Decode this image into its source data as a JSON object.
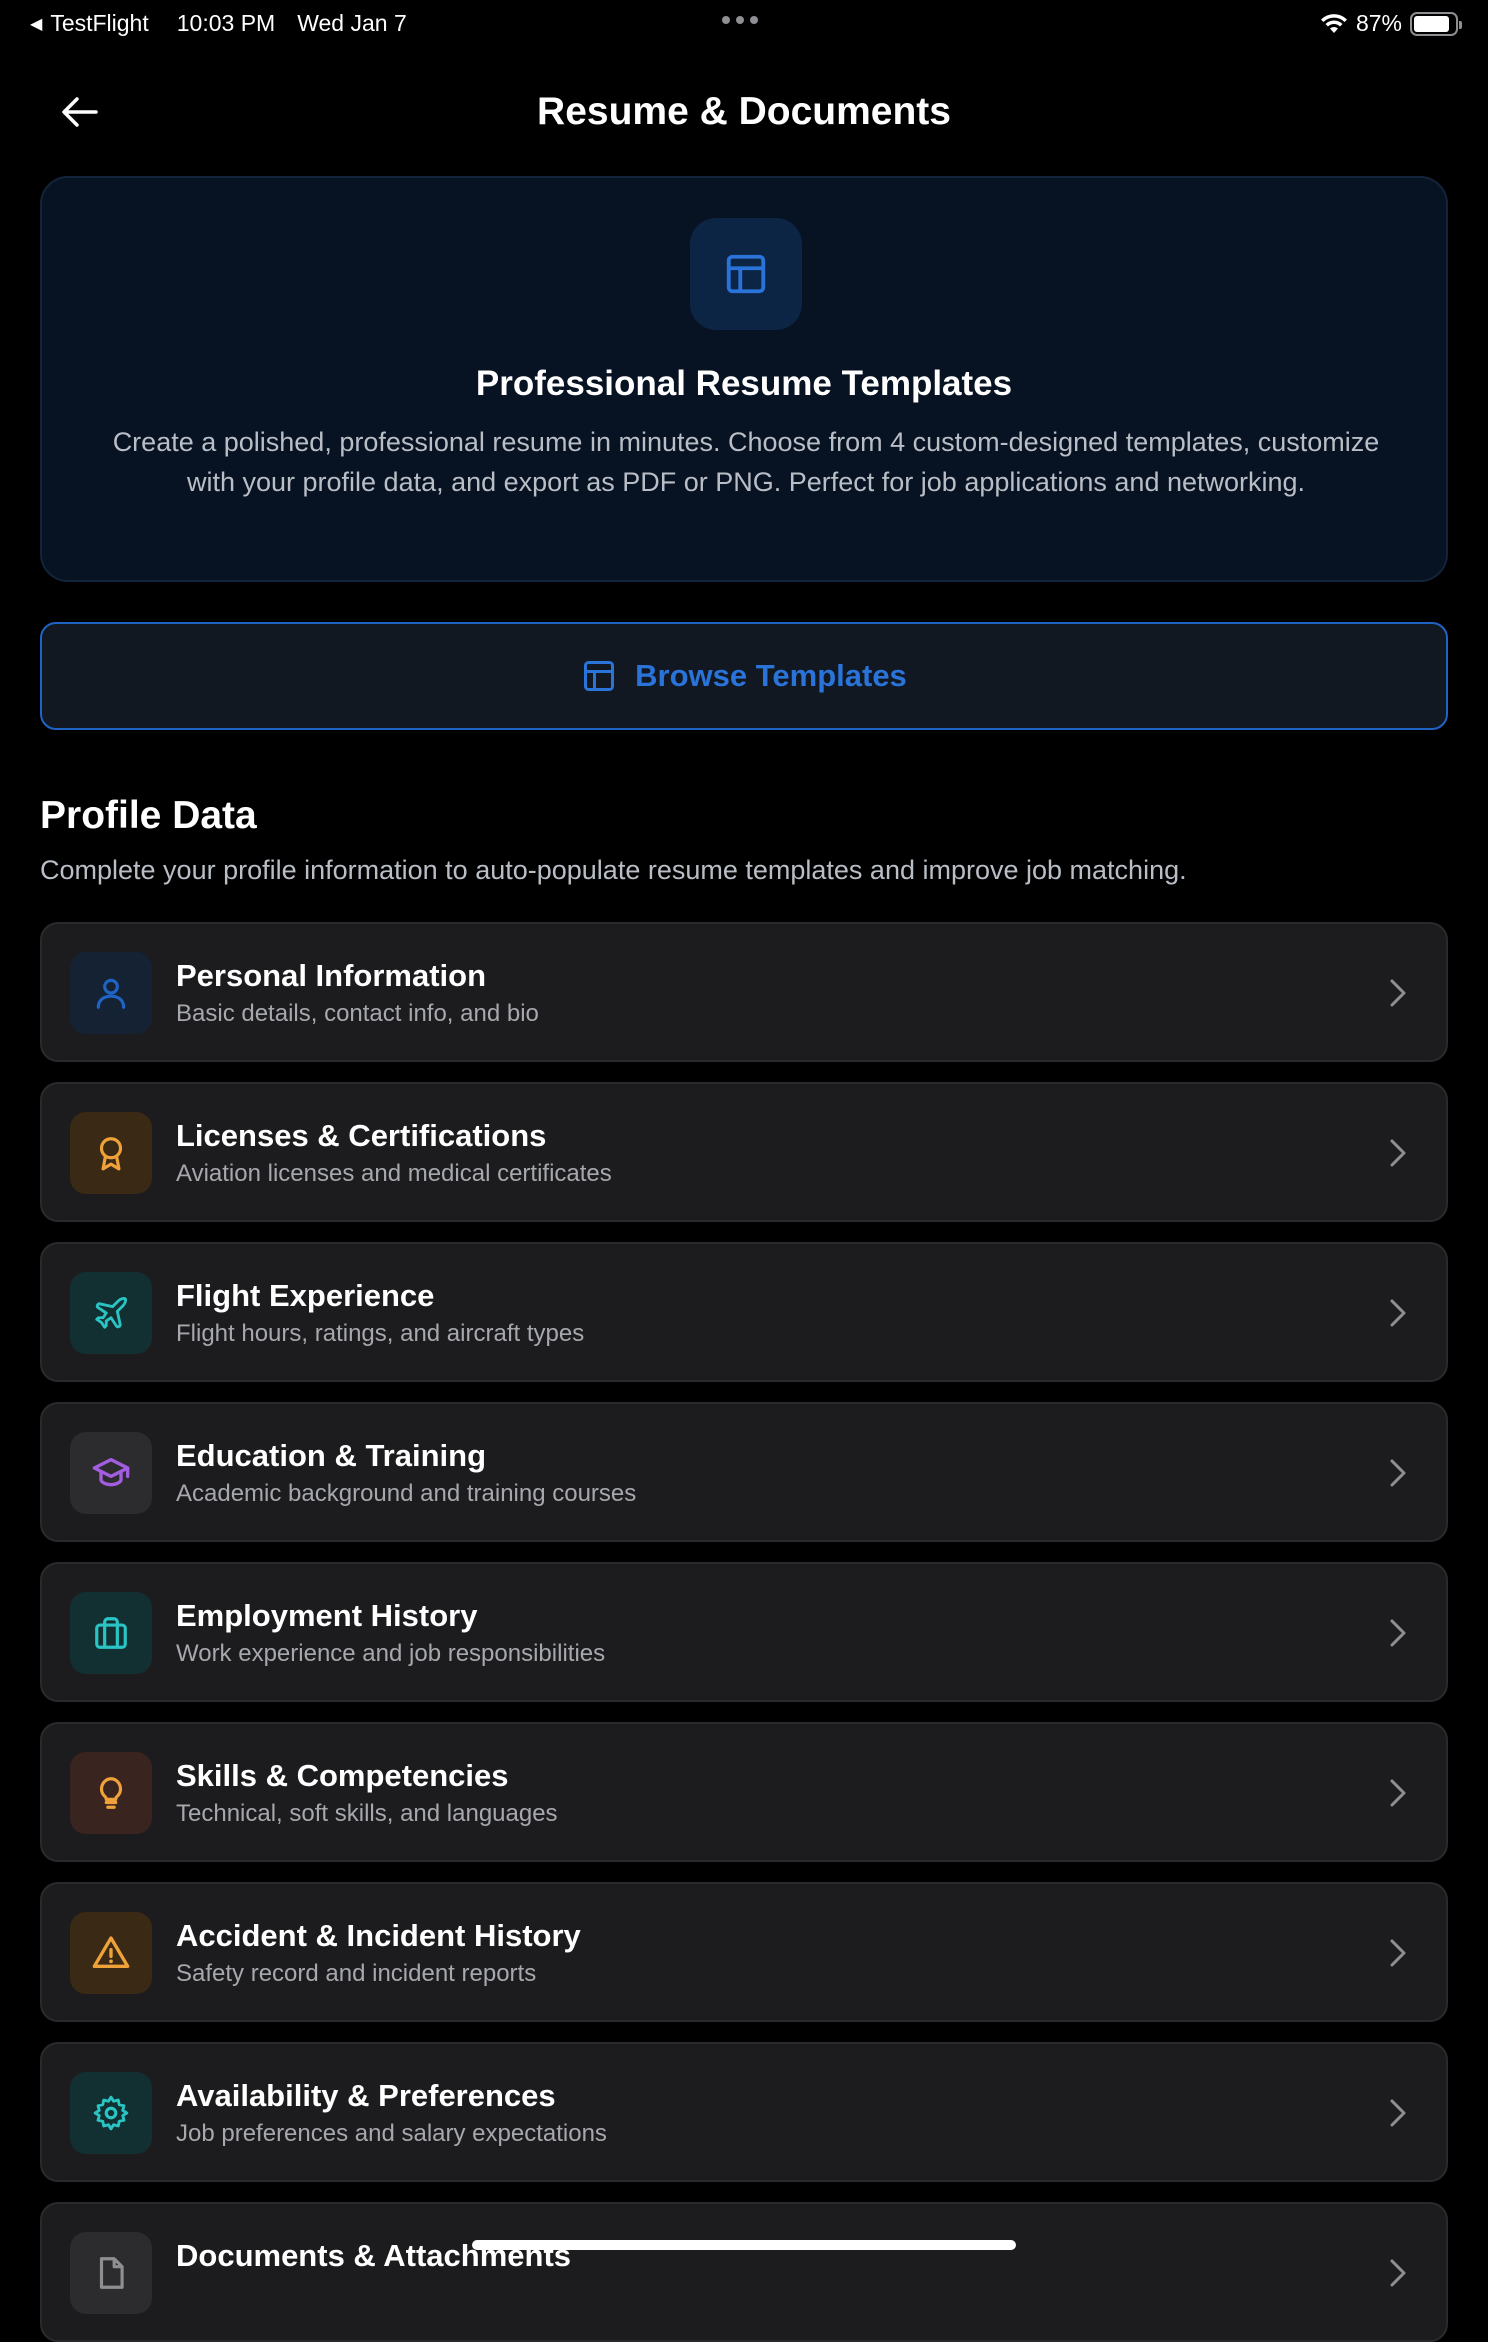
{
  "status_bar": {
    "back_app": "TestFlight",
    "time": "10:03 PM",
    "date": "Wed Jan 7",
    "battery": "87%",
    "battery_level": 0.87
  },
  "nav": {
    "title": "Resume & Documents",
    "back_icon": "arrow-left-icon"
  },
  "hero": {
    "icon": "template-layout-icon",
    "title": "Professional Resume Templates",
    "description": "Create a polished, professional resume in minutes. Choose from 4 custom-designed templates, customize with your profile data, and export as PDF or PNG. Perfect for job applications and networking."
  },
  "browse_button": {
    "label": "Browse Templates",
    "icon": "template-layout-icon"
  },
  "profile_section": {
    "title": "Profile Data",
    "subtitle": "Complete your profile information to auto-populate resume templates and improve job matching."
  },
  "items": [
    {
      "title": "Personal Information",
      "subtitle": "Basic details, contact info, and bio",
      "icon": "user-icon",
      "color": "#1f63c4"
    },
    {
      "title": "Licenses & Certifications",
      "subtitle": "Aviation licenses and medical certificates",
      "icon": "award-icon",
      "color": "#f0a23a"
    },
    {
      "title": "Flight Experience",
      "subtitle": "Flight hours, ratings, and aircraft types",
      "icon": "plane-icon",
      "color": "#2bc4c4"
    },
    {
      "title": "Education & Training",
      "subtitle": "Academic background and training courses",
      "icon": "graduation-cap-icon",
      "color": "#a25de0"
    },
    {
      "title": "Employment History",
      "subtitle": "Work experience and job responsibilities",
      "icon": "briefcase-icon",
      "color": "#2bc4c4"
    },
    {
      "title": "Skills & Competencies",
      "subtitle": "Technical, soft skills, and languages",
      "icon": "lightbulb-icon",
      "color": "#f0a23a"
    },
    {
      "title": "Accident & Incident History",
      "subtitle": "Safety record and incident reports",
      "icon": "warning-icon",
      "color": "#f0a23a"
    },
    {
      "title": "Availability & Preferences",
      "subtitle": "Job preferences and salary expectations",
      "icon": "gear-icon",
      "color": "#2bc4c4"
    },
    {
      "title": "Documents & Attachments",
      "subtitle": "",
      "icon": "document-icon",
      "color": "#8e8e93"
    }
  ]
}
